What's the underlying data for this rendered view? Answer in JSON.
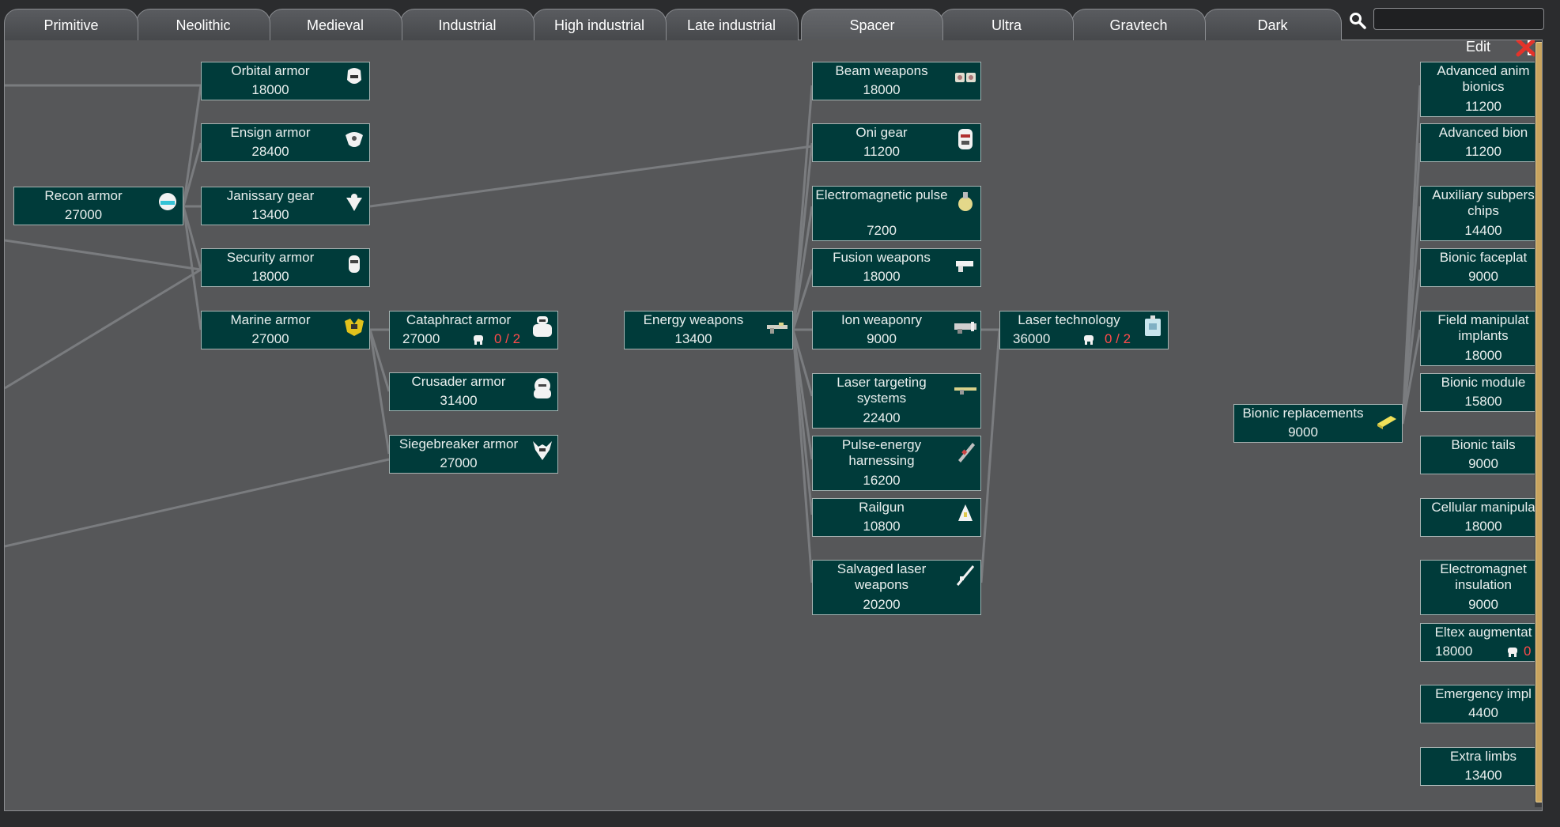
{
  "tabs": [
    {
      "label": "Primitive"
    },
    {
      "label": "Neolithic"
    },
    {
      "label": "Medieval"
    },
    {
      "label": "Industrial"
    },
    {
      "label": "High industrial"
    },
    {
      "label": "Late industrial"
    },
    {
      "label": "Spacer"
    },
    {
      "label": "Ultra"
    },
    {
      "label": "Gravtech"
    },
    {
      "label": "Dark"
    }
  ],
  "active_tab": "Spacer",
  "search": {
    "value": "",
    "icon": "search-icon"
  },
  "toolbar": {
    "edit_label": "Edit",
    "close_icon": "close-icon",
    "clip_icon": "clipboard-icon"
  },
  "colors": {
    "node_bg": "#003b3a",
    "progress": "#ff4b4b",
    "scroll_thumb": "#c9a45f"
  },
  "nodes": [
    {
      "label": "Recon armor",
      "cost": "27000",
      "icon": "recon-helmet-icon"
    },
    {
      "label": "Orbital armor",
      "cost": "18000",
      "icon": "orbital-armor-icon"
    },
    {
      "label": "Ensign armor",
      "cost": "28400",
      "icon": "ensign-armor-icon"
    },
    {
      "label": "Janissary gear",
      "cost": "13400",
      "icon": "janissary-gear-icon"
    },
    {
      "label": "Security armor",
      "cost": "18000",
      "icon": "security-armor-icon"
    },
    {
      "label": "Marine armor",
      "cost": "27000",
      "icon": "marine-armor-icon"
    },
    {
      "label": "Cataphract armor",
      "cost": "27000",
      "icon": "cataphract-armor-icon",
      "progress": "0 / 2",
      "bench": "workbench-icon"
    },
    {
      "label": "Crusader armor",
      "cost": "31400",
      "icon": "crusader-armor-icon"
    },
    {
      "label": "Siegebreaker armor",
      "cost": "27000",
      "icon": "siegebreaker-armor-icon"
    },
    {
      "label": "Energy weapons",
      "cost": "13400",
      "icon": "energy-rifle-icon"
    },
    {
      "label": "Beam weapons",
      "cost": "18000",
      "icon": "beam-weapon-icon"
    },
    {
      "label": "Oni gear",
      "cost": "11200",
      "icon": "oni-gear-icon"
    },
    {
      "label": "Electromagnetic pulse",
      "cost": "7200",
      "icon": "emp-grenade-icon"
    },
    {
      "label": "Fusion weapons",
      "cost": "18000",
      "icon": "fusion-pistol-icon"
    },
    {
      "label": "Ion weaponry",
      "cost": "9000",
      "icon": "ion-gun-icon"
    },
    {
      "label": "Laser targeting systems",
      "cost": "22400",
      "icon": "laser-rifle-icon"
    },
    {
      "label": "Pulse-energy harnessing",
      "cost": "16200",
      "icon": "pulse-rifle-icon"
    },
    {
      "label": "Railgun",
      "cost": "10800",
      "icon": "railgun-icon"
    },
    {
      "label": "Salvaged laser weapons",
      "cost": "20200",
      "icon": "salvaged-laser-icon"
    },
    {
      "label": "Laser technology",
      "cost": "36000",
      "icon": "laser-tech-icon",
      "progress": "0 / 2",
      "bench": "workbench-icon"
    },
    {
      "label": "Bionic replacements",
      "cost": "9000",
      "icon": "bionic-replacement-icon"
    },
    {
      "label": "Advanced anim bionics",
      "cost": "11200"
    },
    {
      "label": "Advanced bion",
      "cost": "11200"
    },
    {
      "label": "Auxiliary subpers chips",
      "cost": "14400"
    },
    {
      "label": "Bionic faceplat",
      "cost": "9000"
    },
    {
      "label": "Field manipulat implants",
      "cost": "18000"
    },
    {
      "label": "Bionic module",
      "cost": "15800"
    },
    {
      "label": "Bionic tails",
      "cost": "9000"
    },
    {
      "label": "Cellular manipula",
      "cost": "18000"
    },
    {
      "label": "Electromagnet insulation",
      "cost": "9000"
    },
    {
      "label": "Eltex augmentat",
      "cost": "18000",
      "bench": "workbench-icon",
      "progress": "0"
    },
    {
      "label": "Emergency impl",
      "cost": "4400"
    },
    {
      "label": "Extra limbs",
      "cost": "13400"
    }
  ]
}
